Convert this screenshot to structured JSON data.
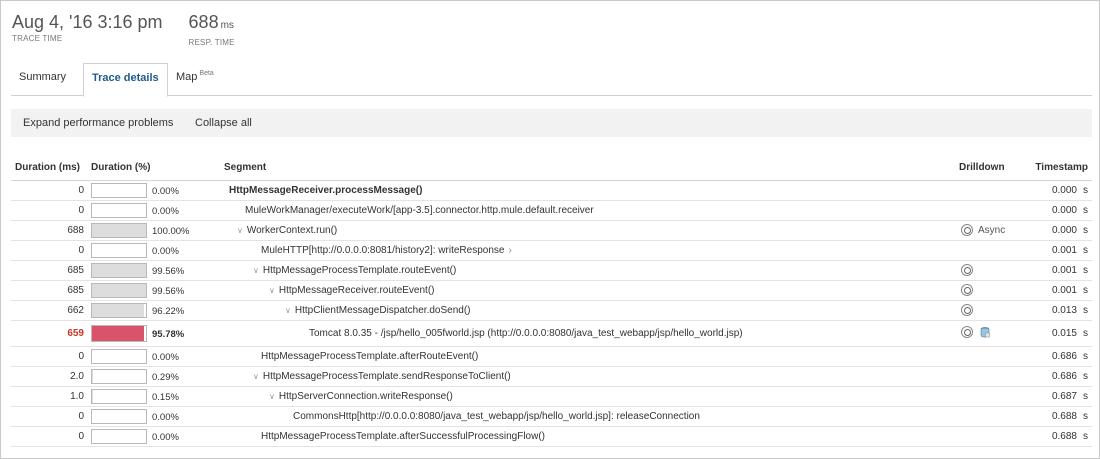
{
  "header": {
    "trace_time": {
      "value": "Aug 4, '16 3:16 pm",
      "caption": "TRACE TIME"
    },
    "resp_time": {
      "value": "688",
      "unit": "ms",
      "caption": "RESP. TIME"
    }
  },
  "tabs": [
    {
      "label": "Summary",
      "active": false
    },
    {
      "label": "Trace details",
      "active": true
    },
    {
      "label": "Map",
      "badge": "Beta",
      "active": false
    }
  ],
  "toolbar": {
    "expand_label": "Expand performance problems",
    "collapse_label": "Collapse all"
  },
  "table": {
    "columns": [
      "Duration (ms)",
      "Duration (%)",
      "Segment",
      "Drilldown",
      "Timestamp"
    ],
    "rows": [
      {
        "ms": "0",
        "pct": "0.00%",
        "fill": 0,
        "segment": "HttpMessageReceiver.processMessage()",
        "indent": 0,
        "chevron": false,
        "ts": "0.000",
        "unit": "s"
      },
      {
        "ms": "0",
        "pct": "0.00%",
        "fill": 0,
        "segment": "MuleWorkManager/executeWork/[app-3.5].connector.http.mule.default.receiver",
        "indent": 1,
        "chevron": false,
        "ts": "0.000",
        "unit": "s"
      },
      {
        "ms": "688",
        "pct": "100.00%",
        "fill": 100,
        "segment": "WorkerContext.run()",
        "indent": 0.5,
        "chevron": true,
        "drill": "Async",
        "ts": "0.000",
        "unit": "s"
      },
      {
        "ms": "0",
        "pct": "0.00%",
        "fill": 0,
        "segment": "MuleHTTP[http://0.0.0.0:8081/history2]: writeResponse",
        "indent": 2,
        "chevron": false,
        "next": "›",
        "ts": "0.001",
        "unit": "s"
      },
      {
        "ms": "685",
        "pct": "99.56%",
        "fill": 99.56,
        "segment": "HttpMessageProcessTemplate.routeEvent()",
        "indent": 1.5,
        "chevron": true,
        "drill": "",
        "ts": "0.001",
        "unit": "s"
      },
      {
        "ms": "685",
        "pct": "99.56%",
        "fill": 99.56,
        "segment": "HttpMessageReceiver.routeEvent()",
        "indent": 2.5,
        "chevron": true,
        "drill": "",
        "ts": "0.001",
        "unit": "s"
      },
      {
        "ms": "662",
        "pct": "96.22%",
        "fill": 96.22,
        "segment": "HttpClientMessageDispatcher.doSend()",
        "indent": 3.5,
        "chevron": true,
        "drill": "",
        "ts": "0.013",
        "unit": "s"
      },
      {
        "ms": "659",
        "pct": "95.78%",
        "fill": 95.78,
        "segment": "Tomcat 8.0.35 - /jsp/hello_005fworld.jsp (http://0.0.0.0:8080/java_test_webapp/jsp/hello_world.jsp)",
        "indent": 5,
        "chevron": false,
        "drill": "",
        "db": true,
        "slow": true,
        "ts": "0.015",
        "unit": "s"
      },
      {
        "ms": "0",
        "pct": "0.00%",
        "fill": 0,
        "segment": "HttpMessageProcessTemplate.afterRouteEvent()",
        "indent": 2,
        "chevron": false,
        "ts": "0.686",
        "unit": "s"
      },
      {
        "ms": "2.0",
        "pct": "0.29%",
        "fill": 0.29,
        "segment": "HttpMessageProcessTemplate.sendResponseToClient()",
        "indent": 1.5,
        "chevron": true,
        "ts": "0.686",
        "unit": "s"
      },
      {
        "ms": "1.0",
        "pct": "0.15%",
        "fill": 0.15,
        "segment": "HttpServerConnection.writeResponse()",
        "indent": 2.5,
        "chevron": true,
        "ts": "0.687",
        "unit": "s"
      },
      {
        "ms": "0",
        "pct": "0.00%",
        "fill": 0,
        "segment": "CommonsHttp[http://0.0.0.0:8080/java_test_webapp/jsp/hello_world.jsp]: releaseConnection",
        "indent": 4,
        "chevron": false,
        "ts": "0.688",
        "unit": "s"
      },
      {
        "ms": "0",
        "pct": "0.00%",
        "fill": 0,
        "segment": "HttpMessageProcessTemplate.afterSuccessfulProcessingFlow()",
        "indent": 2,
        "chevron": false,
        "ts": "0.688",
        "unit": "s"
      }
    ]
  }
}
